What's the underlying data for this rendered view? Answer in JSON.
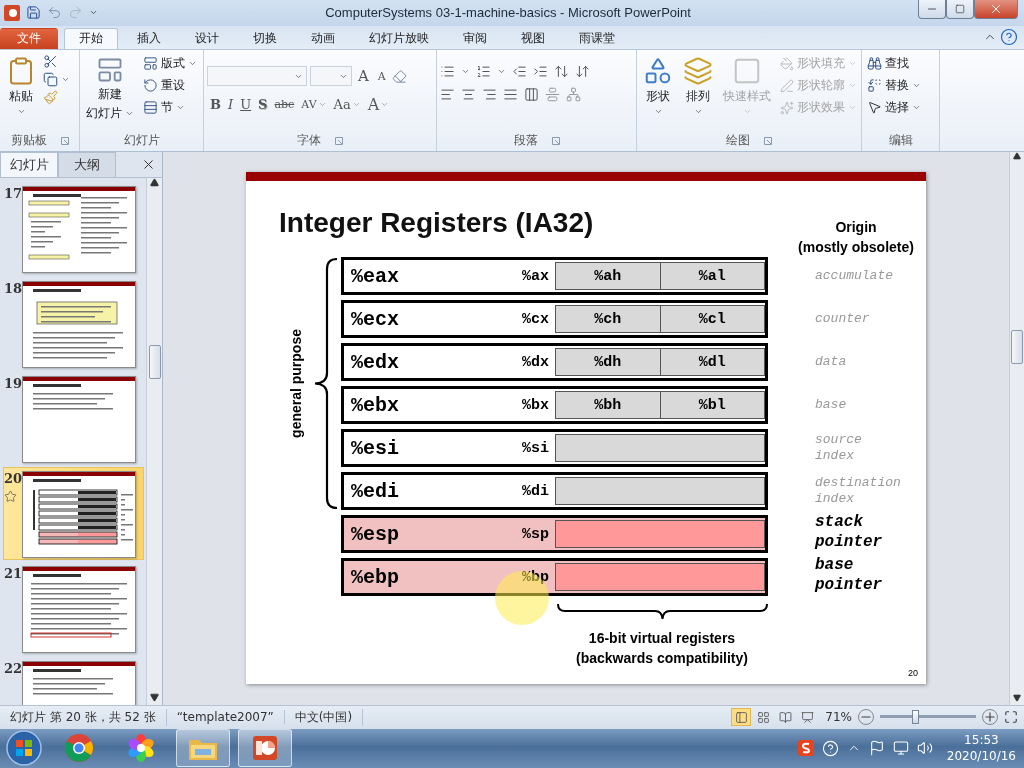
{
  "window": {
    "title": "ComputerSystems 03-1-machine-basics  -  Microsoft PowerPoint"
  },
  "ribbon_tabs": [
    {
      "label": "文件",
      "kind": "file",
      "selected": false
    },
    {
      "label": "开始",
      "kind": "tab",
      "selected": true
    },
    {
      "label": "插入",
      "kind": "tab",
      "selected": false
    },
    {
      "label": "设计",
      "kind": "tab",
      "selected": false
    },
    {
      "label": "切换",
      "kind": "tab",
      "selected": false
    },
    {
      "label": "动画",
      "kind": "tab",
      "selected": false
    },
    {
      "label": "幻灯片放映",
      "kind": "tab",
      "selected": false
    },
    {
      "label": "审阅",
      "kind": "tab",
      "selected": false
    },
    {
      "label": "视图",
      "kind": "tab",
      "selected": false
    },
    {
      "label": "雨课堂",
      "kind": "tab",
      "selected": false
    }
  ],
  "ribbon": {
    "clipboard": {
      "paste": "粘贴",
      "label": "剪贴板"
    },
    "slides": {
      "new_slide": "新建",
      "new_slide_menu": "幻灯片",
      "layout": "版式",
      "reset": "重设",
      "section": "节",
      "label": "幻灯片"
    },
    "font": {
      "grow": "A",
      "shrink": "A",
      "format_buttons": [
        "B",
        "I",
        "U",
        "S",
        "abc",
        "AV",
        "Aa",
        "A"
      ],
      "label": "字体"
    },
    "paragraph": {
      "label": "段落"
    },
    "drawing": {
      "shapes": "形状",
      "arrange": "排列",
      "quick_styles": {
        "label": "快速样式",
        "disabled": true
      },
      "commands": [
        {
          "label": "形状填充",
          "disabled": true
        },
        {
          "label": "形状轮廓",
          "disabled": true
        },
        {
          "label": "形状效果",
          "disabled": true
        }
      ],
      "label": "绘图"
    },
    "editing": {
      "commands": [
        {
          "label": "查找",
          "kind": "find"
        },
        {
          "label": "替换",
          "kind": "replace"
        },
        {
          "label": "选择",
          "kind": "select"
        }
      ],
      "label": "编辑"
    }
  },
  "panel": {
    "tabs": [
      {
        "label": "幻灯片",
        "selected": true
      },
      {
        "label": "大纲",
        "selected": false
      }
    ],
    "thumbnails": [
      {
        "number": "17",
        "kind": "code",
        "selected": false,
        "animated": false
      },
      {
        "number": "18",
        "kind": "table",
        "selected": false,
        "animated": false
      },
      {
        "number": "19",
        "kind": "bullets",
        "selected": false,
        "animated": false
      },
      {
        "number": "20",
        "kind": "registers",
        "selected": true,
        "animated": true
      },
      {
        "number": "21",
        "kind": "grid",
        "selected": false,
        "animated": false
      },
      {
        "number": "22",
        "kind": "bullets",
        "selected": false,
        "animated": false
      }
    ]
  },
  "slide": {
    "title": "Integer Registers (IA32)",
    "origin_heading": [
      "Origin",
      "(mostly obsolete)"
    ],
    "group_label": "general purpose",
    "registers": [
      {
        "name": "%eax",
        "short": "%ax",
        "high": "%ah",
        "low": "%al",
        "origin": [
          "accumulate"
        ],
        "kind": "general"
      },
      {
        "name": "%ecx",
        "short": "%cx",
        "high": "%ch",
        "low": "%cl",
        "origin": [
          "counter"
        ],
        "kind": "general"
      },
      {
        "name": "%edx",
        "short": "%dx",
        "high": "%dh",
        "low": "%dl",
        "origin": [
          "data"
        ],
        "kind": "general"
      },
      {
        "name": "%ebx",
        "short": "%bx",
        "high": "%bh",
        "low": "%bl",
        "origin": [
          "base"
        ],
        "kind": "general"
      },
      {
        "name": "%esi",
        "short": "%si",
        "origin": [
          "source",
          "index"
        ],
        "kind": "general"
      },
      {
        "name": "%edi",
        "short": "%di",
        "origin": [
          "destination",
          "index"
        ],
        "kind": "general"
      },
      {
        "name": "%esp",
        "short": "%sp",
        "origin": [
          "stack",
          "pointer"
        ],
        "kind": "special"
      },
      {
        "name": "%ebp",
        "short": "%bp",
        "origin": [
          "base",
          "pointer"
        ],
        "kind": "special"
      }
    ],
    "caption": [
      "16-bit virtual registers",
      "(backwards compatibility)"
    ],
    "page_number": "20"
  },
  "status_bar": {
    "slide_info": "幻灯片 第 20 张，共 52 张",
    "theme": "“template2007”",
    "language": "中文(中国)",
    "views": [
      {
        "kind": "normal",
        "selected": true
      },
      {
        "kind": "sorter",
        "selected": false
      },
      {
        "kind": "reading",
        "selected": false
      },
      {
        "kind": "show",
        "selected": false
      }
    ],
    "zoom": "71%",
    "zoom_slider": {
      "level": 0.36
    }
  },
  "taskbar": {
    "apps": [
      {
        "kind": "chrome",
        "running": false
      },
      {
        "kind": "pinwheel",
        "running": false
      },
      {
        "kind": "explorer",
        "running": true
      },
      {
        "kind": "powerpoint",
        "running": true
      }
    ],
    "time": "15:53",
    "date": "2020/10/16"
  }
}
